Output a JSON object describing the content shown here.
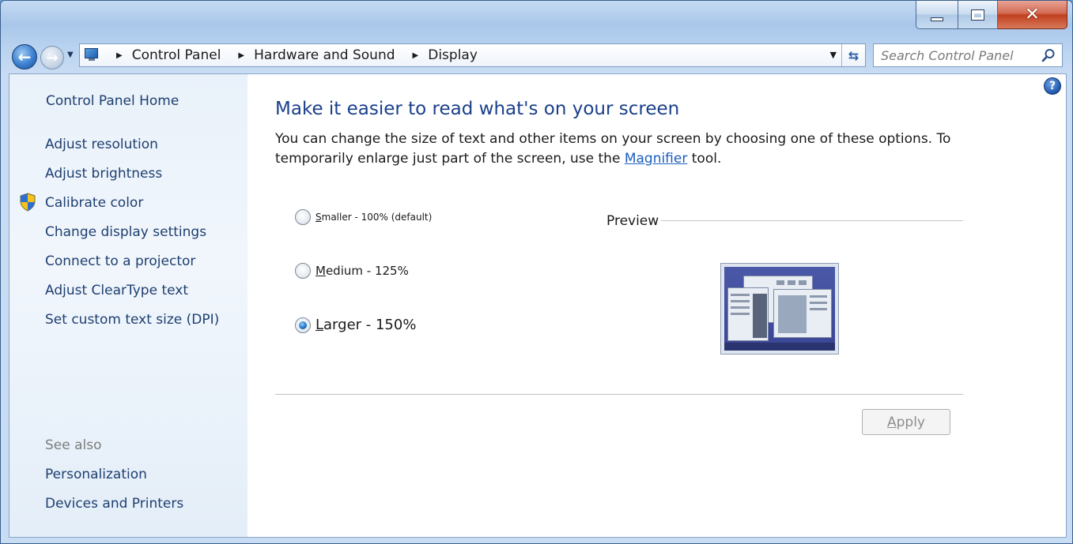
{
  "window": {
    "caption": {
      "close_glyph": "✕"
    }
  },
  "nav": {
    "breadcrumbs": [
      "Control Panel",
      "Hardware and Sound",
      "Display"
    ],
    "search_placeholder": "Search Control Panel"
  },
  "sidebar": {
    "home": "Control Panel Home",
    "links": [
      "Adjust resolution",
      "Adjust brightness",
      "Calibrate color",
      "Change display settings",
      "Connect to a projector",
      "Adjust ClearType text",
      "Set custom text size (DPI)"
    ],
    "see_also_heading": "See also",
    "see_also": [
      "Personalization",
      "Devices and Printers"
    ]
  },
  "main": {
    "title": "Make it easier to read what's on your screen",
    "desc_before": "You can change the size of text and other items on your screen by choosing one of these options. To temporarily enlarge just part of the screen, use the ",
    "desc_link": "Magnifier",
    "desc_after": " tool.",
    "options": [
      {
        "accel": "S",
        "rest": "maller - 100% (default)",
        "checked": false
      },
      {
        "accel": "M",
        "rest": "edium - 125%",
        "checked": false
      },
      {
        "accel": "L",
        "rest": "arger - 150%",
        "checked": true
      }
    ],
    "preview_label": "Preview",
    "apply": {
      "accel": "A",
      "rest": "pply"
    }
  },
  "colors": {
    "link": "#1e3f70",
    "title": "#1a3f8a",
    "hyperlink": "#1a5dc0",
    "close_button": "#c0401f"
  }
}
